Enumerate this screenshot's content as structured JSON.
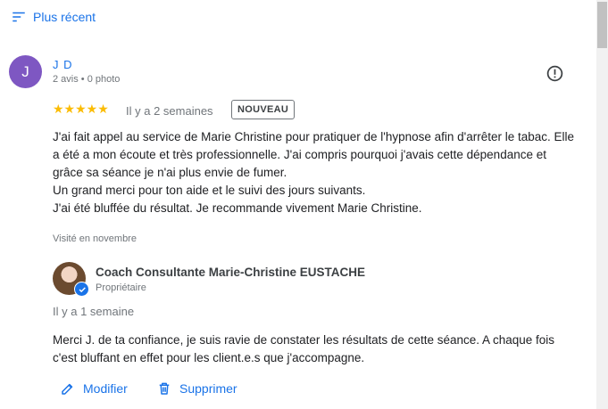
{
  "sort": {
    "label": "Plus récent",
    "icon": "sort-icon"
  },
  "review": {
    "avatar_letter": "J",
    "avatar_color": "#7e57c2",
    "author": "J D",
    "author_meta": "2 avis • 0 photo",
    "rating": 5,
    "stars_text": "★★★★★",
    "date": "Il y a 2 semaines",
    "badge": "NOUVEAU",
    "text_lines": [
      "J'ai fait appel au service de Marie Christine pour pratiquer de l'hypnose afin d'arrêter le tabac. Elle a été a mon écoute et très professionnelle. J'ai compris pourquoi j'avais cette dépendance et grâce sa séance je n'ai plus envie de fumer.",
      "Un grand merci pour ton aide et le suivi des jours suivants.",
      "J'ai été bluffée du résultat. Je recommande vivement Marie Christine."
    ],
    "visited": "Visité en novembre"
  },
  "owner_reply": {
    "name": "Coach Consultante Marie-Christine EUSTACHE",
    "role": "Propriétaire",
    "date": "Il y a 1 semaine",
    "text": "Merci J. de ta confiance, je suis ravie de constater les résultats de cette séance. A chaque fois c'est bluffant en effet pour les client.e.s que j'accompagne."
  },
  "actions": {
    "edit_label": "Modifier",
    "delete_label": "Supprimer"
  },
  "colors": {
    "accent": "#1a73e8",
    "star": "#fbbc04",
    "muted": "#70757a"
  }
}
